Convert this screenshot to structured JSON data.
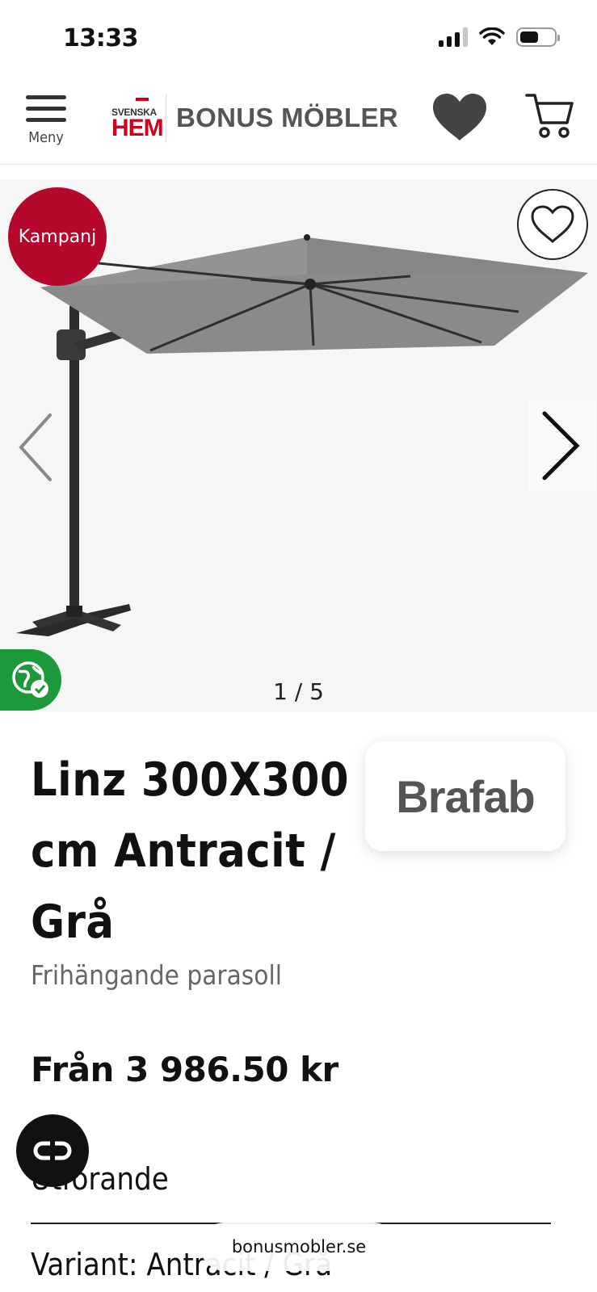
{
  "status_bar": {
    "time": "13:33"
  },
  "header": {
    "menu_label": "Meny",
    "logo_small": "SVENSKA",
    "logo_hem": "HEM",
    "logo_text": "BONUS MÖBLER"
  },
  "gallery": {
    "badge": "Kampanj",
    "pager": "1 / 5"
  },
  "product": {
    "title": "Linz 300X300 cm Antracit / Grå",
    "subtitle": "Frihängande parasoll",
    "brand": "Brafab",
    "price": "Från 3 986.50 kr",
    "color_label": "Utförande",
    "variant": "Variant: Antracit / Grå"
  },
  "browser": {
    "url": "bonusmobler.se"
  },
  "colors": {
    "accent": "#b5082c",
    "eco": "#1c9a3a",
    "brand_red": "#d0021b"
  }
}
